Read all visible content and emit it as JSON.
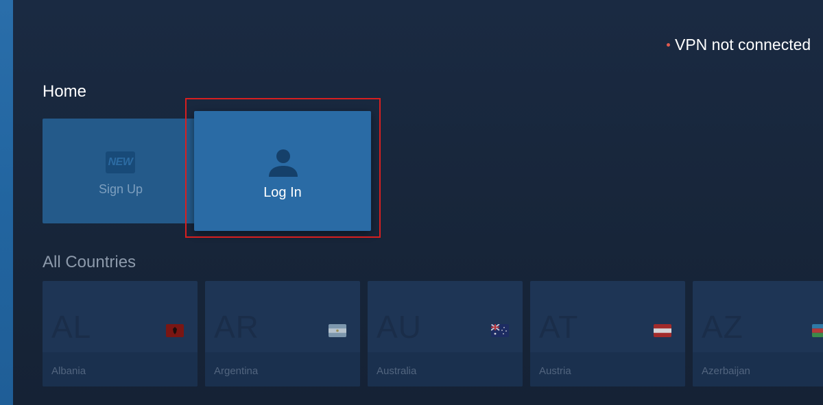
{
  "status": {
    "vpn_text": "VPN not connected",
    "dot_color": "#e05a4f"
  },
  "home": {
    "title": "Home",
    "signup": {
      "badge": "NEW",
      "label": "Sign Up",
      "icon": "new-badge-icon"
    },
    "login": {
      "label": "Log In",
      "icon": "user-icon",
      "focused": true
    }
  },
  "countries": {
    "title": "All Countries",
    "items": [
      {
        "code": "AL",
        "name": "Albania",
        "flag_icon": "albania-flag-icon"
      },
      {
        "code": "AR",
        "name": "Argentina",
        "flag_icon": "argentina-flag-icon"
      },
      {
        "code": "AU",
        "name": "Australia",
        "flag_icon": "australia-flag-icon"
      },
      {
        "code": "AT",
        "name": "Austria",
        "flag_icon": "austria-flag-icon"
      },
      {
        "code": "AZ",
        "name": "Azerbaijan",
        "flag_icon": "azerbaijan-flag-icon"
      }
    ]
  },
  "colors": {
    "focus_outline": "#d81f1f",
    "accent": "#2a6ba5"
  }
}
